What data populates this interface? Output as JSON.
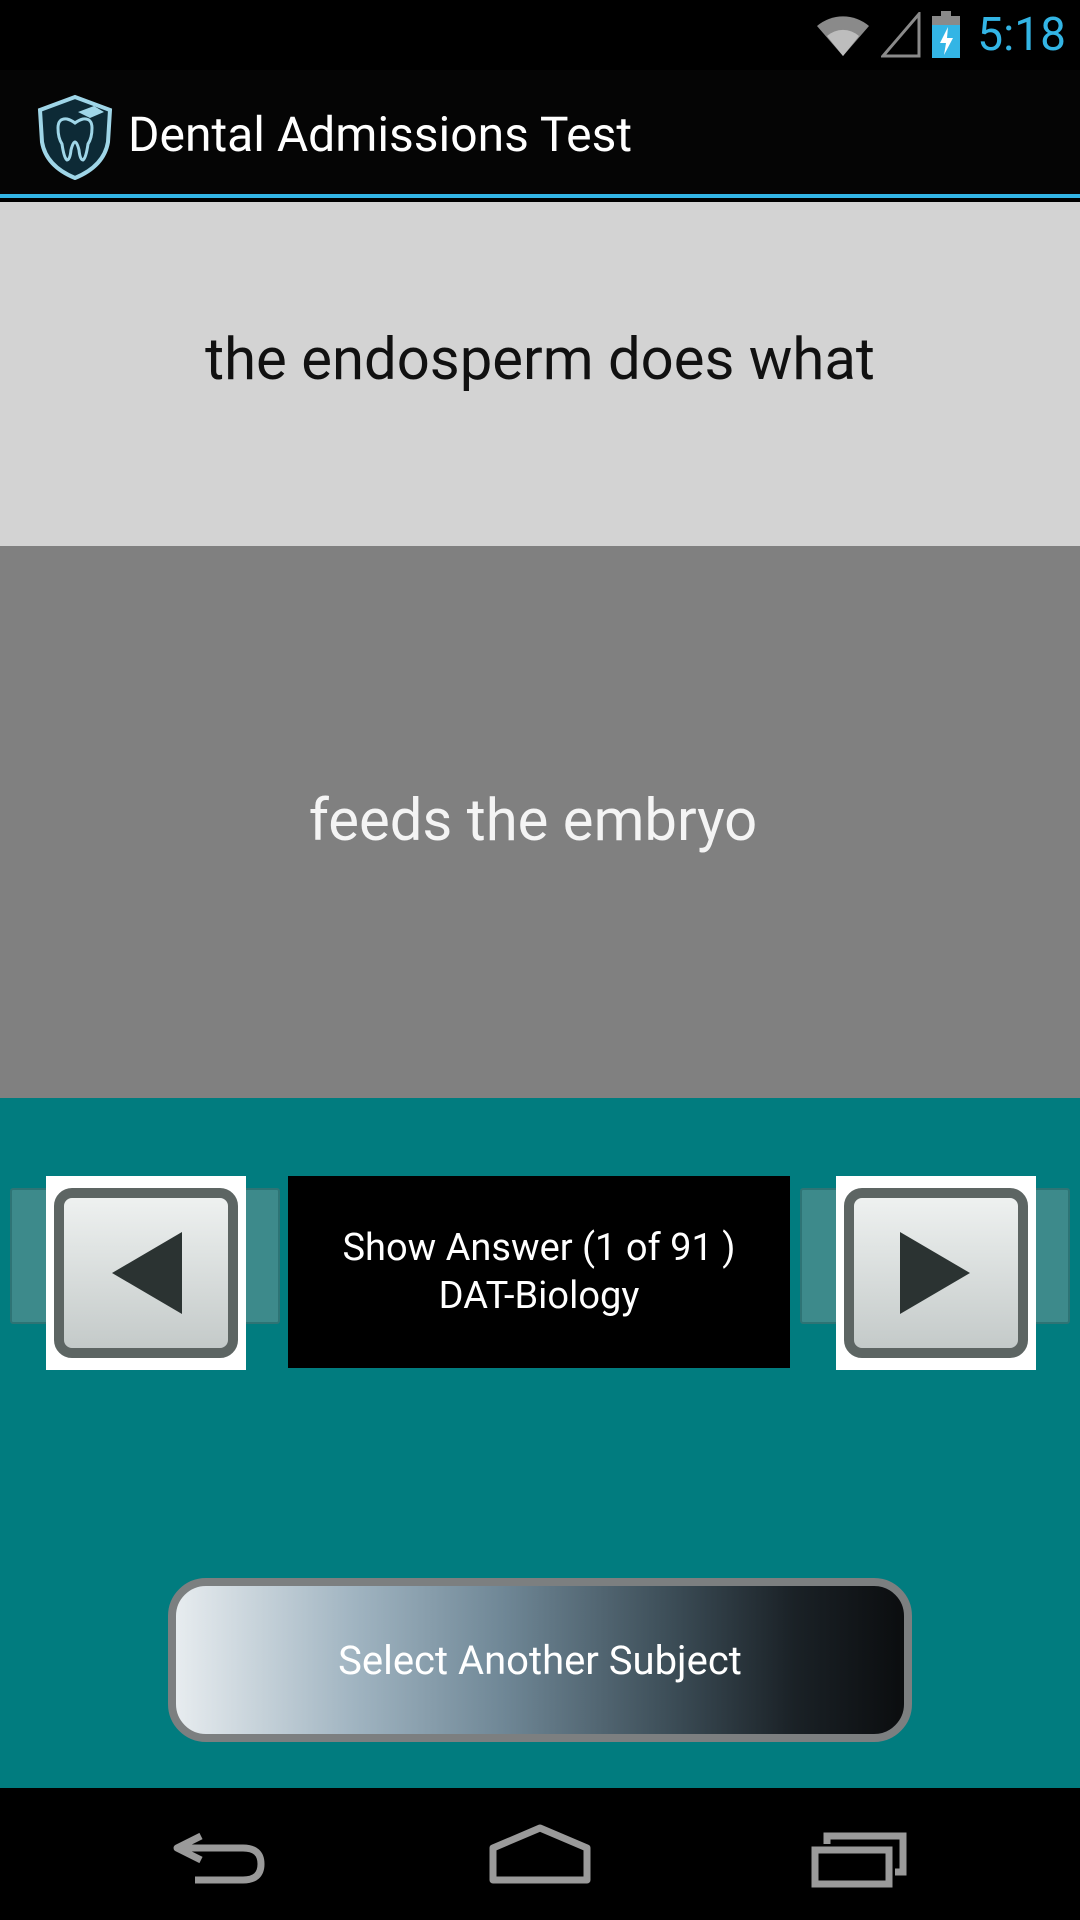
{
  "status_bar": {
    "time": "5:18",
    "icons": [
      "wifi-icon",
      "signal-icon",
      "battery-charging-icon"
    ],
    "accent_color": "#33b5e5"
  },
  "action_bar": {
    "title": "Dental Admissions Test",
    "icon": "tooth-shield-icon"
  },
  "card": {
    "question": "the endosperm does what",
    "answer": "feeds the embryo"
  },
  "controls": {
    "prev_icon": "arrow-left-icon",
    "next_icon": "arrow-right-icon",
    "show_answer_line1": "Show Answer  (1 of 91 )",
    "show_answer_line2": "DAT-Biology",
    "select_subject_label": "Select Another Subject"
  },
  "nav_bar": {
    "icons": [
      "back-icon",
      "home-icon",
      "recents-icon"
    ]
  },
  "colors": {
    "question_bg": "#d3d3d3",
    "answer_bg": "#808080",
    "controls_bg": "#017c7f"
  }
}
